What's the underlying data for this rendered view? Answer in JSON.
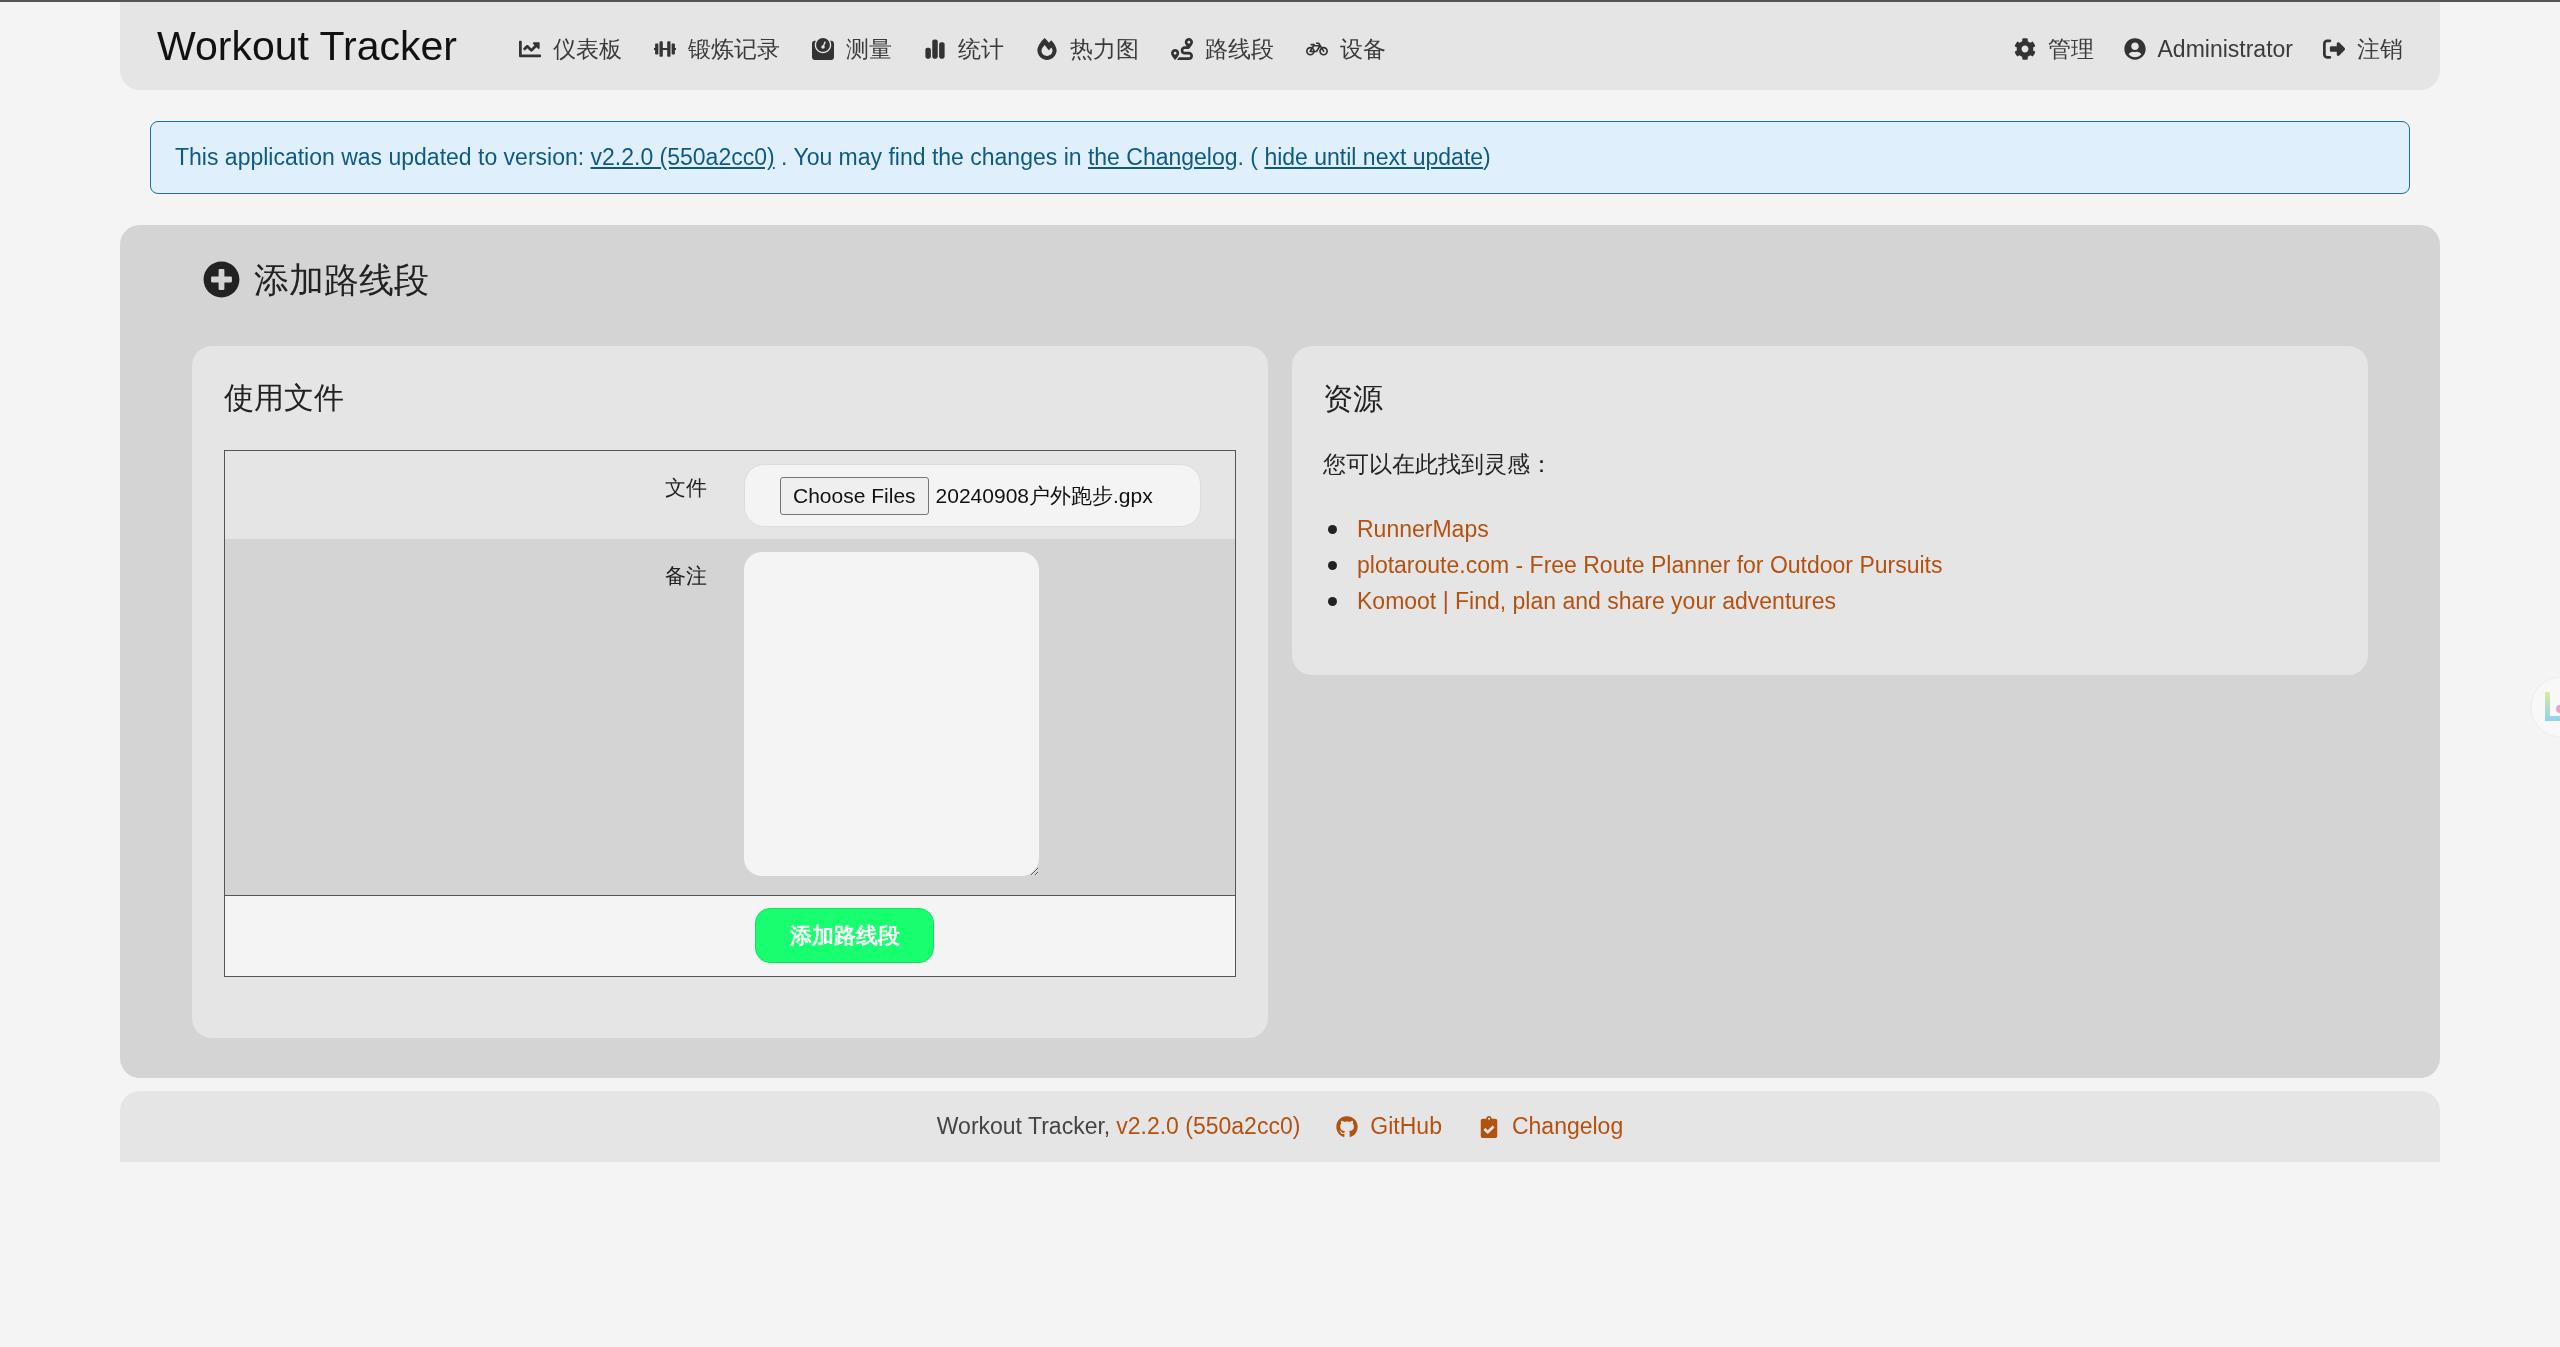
{
  "navbar": {
    "brand": "Workout Tracker",
    "items": [
      {
        "label": "仪表板"
      },
      {
        "label": "锻炼记录"
      },
      {
        "label": "测量"
      },
      {
        "label": "统计"
      },
      {
        "label": "热力图"
      },
      {
        "label": "路线段"
      },
      {
        "label": "设备"
      }
    ],
    "right_items": [
      {
        "label": "管理"
      },
      {
        "label": "Administrator"
      },
      {
        "label": "注销"
      }
    ]
  },
  "notice": {
    "text_1": "This application was updated to version:",
    "version_link": "v2.2.0 (550a2cc0)",
    "text_2": ". You may find the changes in",
    "changelog_link": "the Changelog",
    "text_3": ". (",
    "hide_link": "hide until next update",
    "text_4": ")"
  },
  "page": {
    "title": "添加路线段",
    "upload_card": {
      "title": "使用文件",
      "file_label": "文件",
      "file_button": "Choose Files",
      "file_name": "20240908户外跑步.gpx",
      "notes_label": "备注",
      "submit": "添加路线段"
    },
    "resources_card": {
      "title": "资源",
      "intro": "您可以在此找到灵感：",
      "links": [
        "RunnerMaps",
        "plotaroute.com - Free Route Planner for Outdoor Pursuits",
        "Komoot | Find, plan and share your adventures"
      ]
    }
  },
  "footer": {
    "app_name": "Workout Tracker,",
    "version_link": "v2.2.0 (550a2cc0)",
    "links": [
      {
        "label": "GitHub"
      },
      {
        "label": "Changelog"
      }
    ]
  }
}
